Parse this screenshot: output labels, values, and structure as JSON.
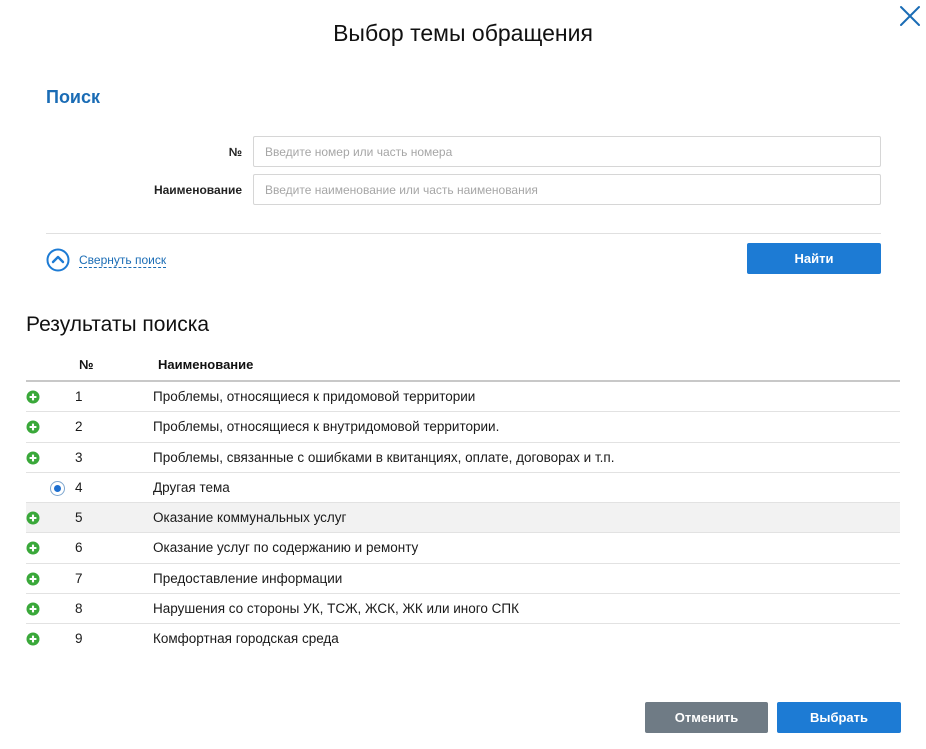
{
  "dialog": {
    "title": "Выбор темы обращения",
    "close_icon": "close-icon"
  },
  "search": {
    "section_title": "Поиск",
    "number_label": "№",
    "number_placeholder": "Введите номер или часть номера",
    "name_label": "Наименование",
    "name_placeholder": "Введите наименование или часть наименования",
    "collapse_label": "Свернуть поиск",
    "collapse_icon": "chevron-up-circle-icon",
    "find_label": "Найти"
  },
  "results": {
    "title": "Результаты поиска",
    "columns": {
      "num": "№",
      "name": "Наименование"
    },
    "rows": [
      {
        "num": "1",
        "name": "Проблемы, относящиеся к придомовой территории",
        "control": "expand",
        "icon": "plus-circle-icon"
      },
      {
        "num": "2",
        "name": "Проблемы, относящиеся к внутридомовой территории.",
        "control": "expand",
        "icon": "plus-circle-icon"
      },
      {
        "num": "3",
        "name": "Проблемы, связанные с ошибками в квитанциях, оплате, договорах и т.п.",
        "control": "expand",
        "icon": "plus-circle-icon"
      },
      {
        "num": "4",
        "name": "Другая тема",
        "control": "radio",
        "selected": true,
        "icon": "radio-selected-icon"
      },
      {
        "num": "5",
        "name": "Оказание коммунальных услуг",
        "control": "expand",
        "icon": "plus-circle-icon"
      },
      {
        "num": "6",
        "name": "Оказание услуг по содержанию и ремонту",
        "control": "expand",
        "icon": "plus-circle-icon"
      },
      {
        "num": "7",
        "name": "Предоставление информации",
        "control": "expand",
        "icon": "plus-circle-icon"
      },
      {
        "num": "8",
        "name": "Нарушения со стороны УК, ТСЖ, ЖСК, ЖК или иного СПК",
        "control": "expand",
        "icon": "plus-circle-icon"
      },
      {
        "num": "9",
        "name": "Комфортная городская среда",
        "control": "expand",
        "icon": "plus-circle-icon"
      }
    ]
  },
  "footer": {
    "cancel_label": "Отменить",
    "select_label": "Выбрать"
  },
  "colors": {
    "accent": "#1d7bd4",
    "link": "#1a6cb5",
    "expand_green": "#3aa83a",
    "cancel_gray": "#6f7b85",
    "hover_row": "#f2f2f2"
  }
}
